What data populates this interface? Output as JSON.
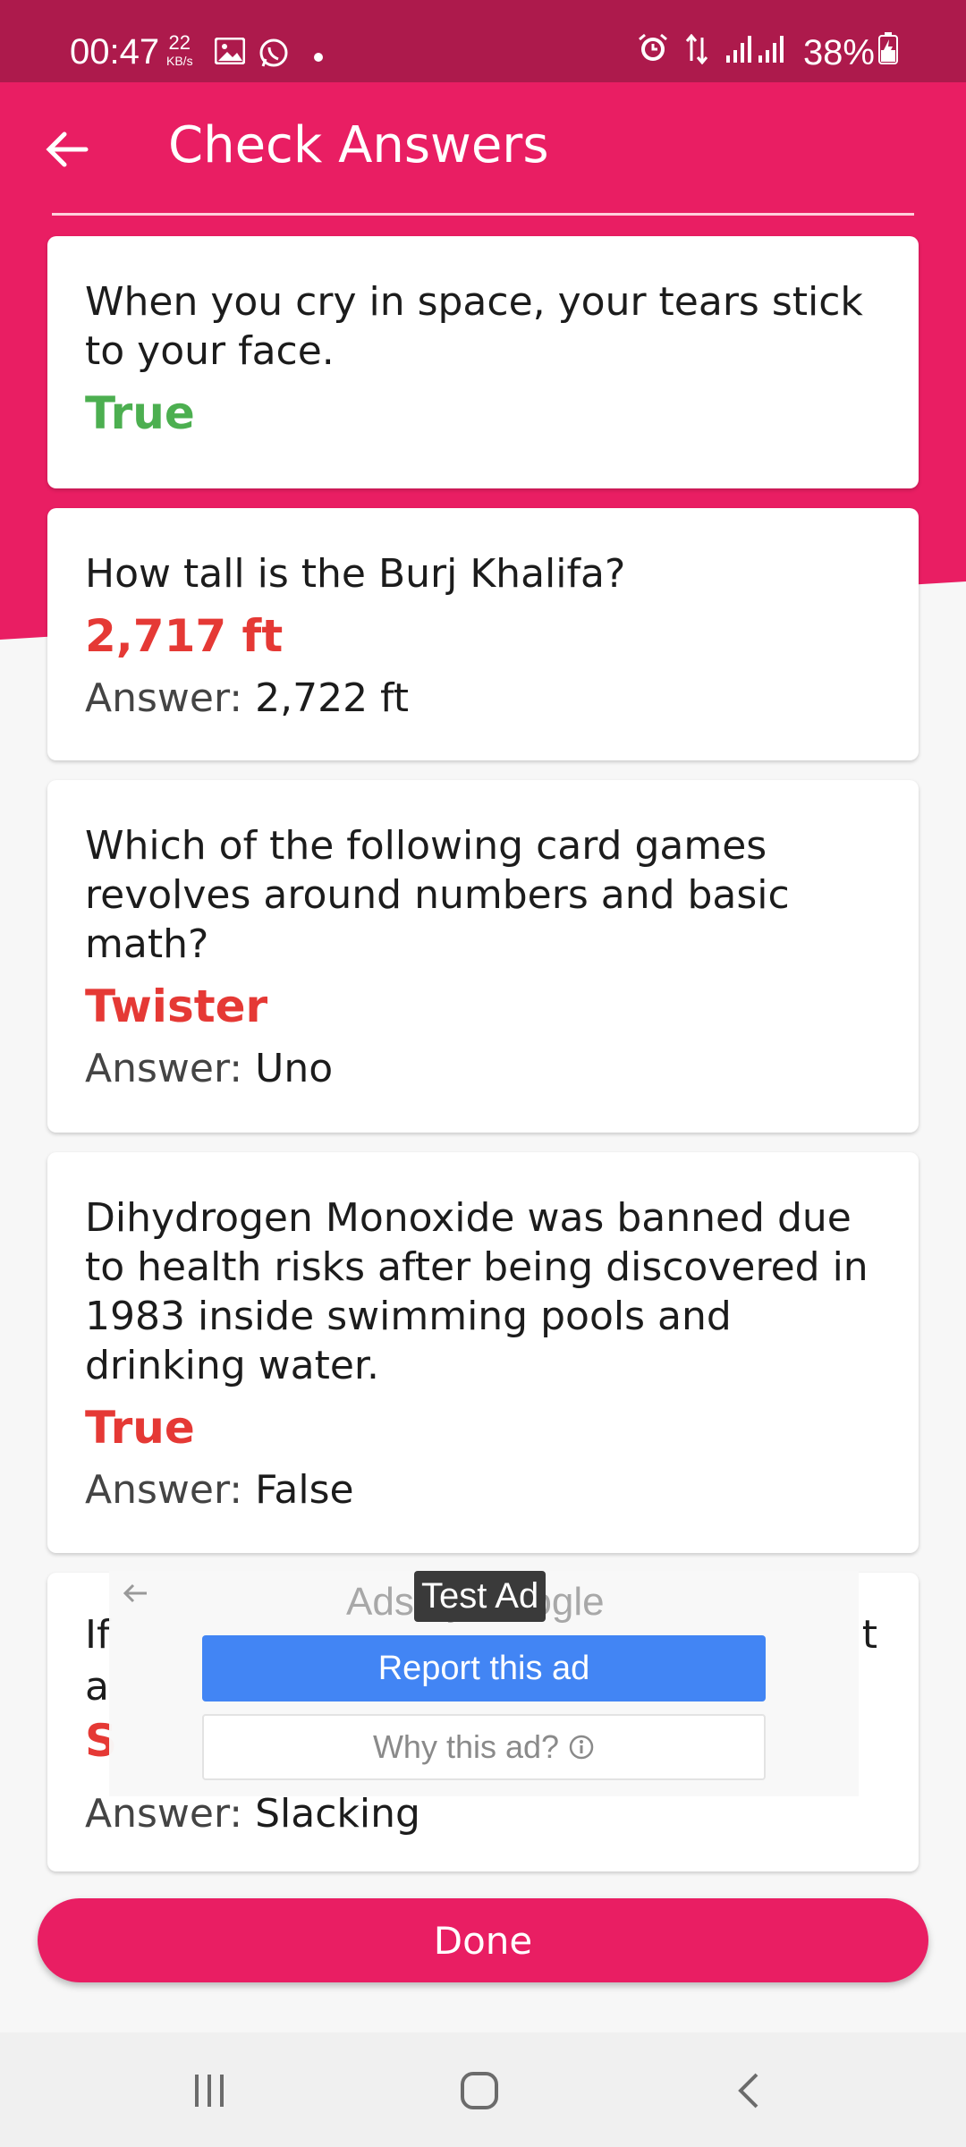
{
  "status_bar": {
    "time": "00:47",
    "net_speed_value": "22",
    "net_speed_unit": "KB/s",
    "battery": "38%"
  },
  "app_bar": {
    "title": "Check Answers"
  },
  "cards": [
    {
      "question": "When you cry in space, your tears stick to your face.",
      "user_answer": "True",
      "user_correct": true,
      "answer_label": "",
      "answer_value": ""
    },
    {
      "question": "How tall is the Burj Khalifa?",
      "user_answer": "2,717 ft",
      "user_correct": false,
      "answer_label": "Answer:",
      "answer_value": "2,722 ft"
    },
    {
      "question": "Which of the following card games revolves around numbers and basic math?",
      "user_answer": "Twister",
      "user_correct": false,
      "answer_label": "Answer:",
      "answer_value": "Uno"
    },
    {
      "question": "Dihydrogen Monoxide was banned due to health risks after being discovered in 1983 inside swimming pools and drinking water.",
      "user_answer": "True",
      "user_correct": false,
      "answer_label": "Answer:",
      "answer_value": "False"
    },
    {
      "question_visible_start": "If",
      "question_visible_end": "t",
      "question_visible_line2": "a",
      "user_answer_visible": "S",
      "answer_label": "Answer:",
      "answer_value": "Slacking"
    }
  ],
  "ad": {
    "ads_by": "Ads by Google",
    "badge": "Test Ad",
    "report_label": "Report this ad",
    "why_label": "Why this ad?"
  },
  "done_label": "Done",
  "colors": {
    "primary": "#e91e63",
    "status": "#ad1a4c",
    "correct": "#4caf50",
    "wrong": "#e53935",
    "ad_blue": "#4285f4"
  },
  "icons": [
    "back-arrow-icon",
    "gallery-icon",
    "whatsapp-icon",
    "alarm-icon",
    "data-arrows-icon",
    "signal-icon",
    "battery-charging-icon",
    "info-icon",
    "recents-icon",
    "home-icon",
    "nav-back-icon"
  ]
}
